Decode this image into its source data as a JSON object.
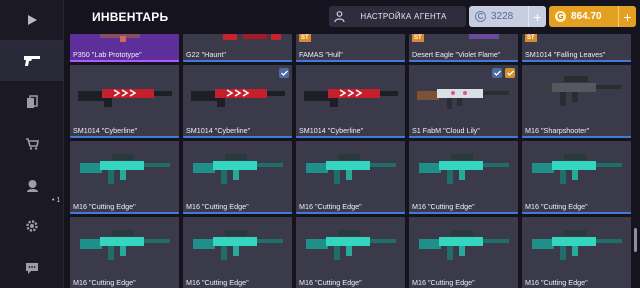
{
  "header": {
    "title": "ИНВЕНТАРЬ",
    "agent_button": "НАСТРОЙКА АГЕНТА",
    "silver": {
      "amount": "3228",
      "symbol": "C"
    },
    "gold": {
      "amount": "864.70",
      "symbol": "G"
    }
  },
  "sidebar": {
    "items": [
      {
        "icon": "play-icon"
      },
      {
        "icon": "pistol-icon"
      },
      {
        "icon": "copy-icon"
      },
      {
        "icon": "cart-icon"
      },
      {
        "icon": "agent-icon"
      },
      {
        "icon": "gear-icon"
      },
      {
        "icon": "chat-icon"
      }
    ],
    "agent_count": "• 1"
  },
  "inventory": {
    "row1": [
      {
        "name": "P350 \"Lab Prototype\"",
        "rarity": "purple",
        "st": false
      },
      {
        "name": "G22 \"Haunt\"",
        "rarity": "blue",
        "st": false
      },
      {
        "name": "FAMAS \"Hull\"",
        "rarity": "blue",
        "st": true,
        "st_label": "ST"
      },
      {
        "name": "Desert Eagle \"Violet Flame\"",
        "rarity": "blue",
        "st": true,
        "st_label": "ST"
      },
      {
        "name": "SM1014 \"Falling Leaves\"",
        "rarity": "blue",
        "st": true,
        "st_label": "ST"
      }
    ],
    "row2": [
      {
        "name": "SM1014 \"Cyberline\""
      },
      {
        "name": "SM1014 \"Cyberline\""
      },
      {
        "name": "SM1014 \"Cyberline\""
      },
      {
        "name": "S1 FabM \"Cloud Lily\""
      },
      {
        "name": "M16 \"Sharpshooter\""
      }
    ],
    "row3": [
      {
        "name": "M16 \"Cutting Edge\""
      },
      {
        "name": "M16 \"Cutting Edge\""
      },
      {
        "name": "M16 \"Cutting Edge\""
      },
      {
        "name": "M16 \"Cutting Edge\""
      },
      {
        "name": "M16 \"Cutting Edge\""
      }
    ],
    "row4": [
      {
        "name": "M16 \"Cutting Edge\""
      },
      {
        "name": "M16 \"Cutting Edge\""
      },
      {
        "name": "M16 \"Cutting Edge\""
      },
      {
        "name": "M16 \"Cutting Edge\""
      },
      {
        "name": "M16 \"Cutting Edge\""
      }
    ]
  },
  "colors": {
    "accent_blue": "#3f7bd8",
    "accent_purple": "#b05bff",
    "gold": "#e3a021"
  }
}
